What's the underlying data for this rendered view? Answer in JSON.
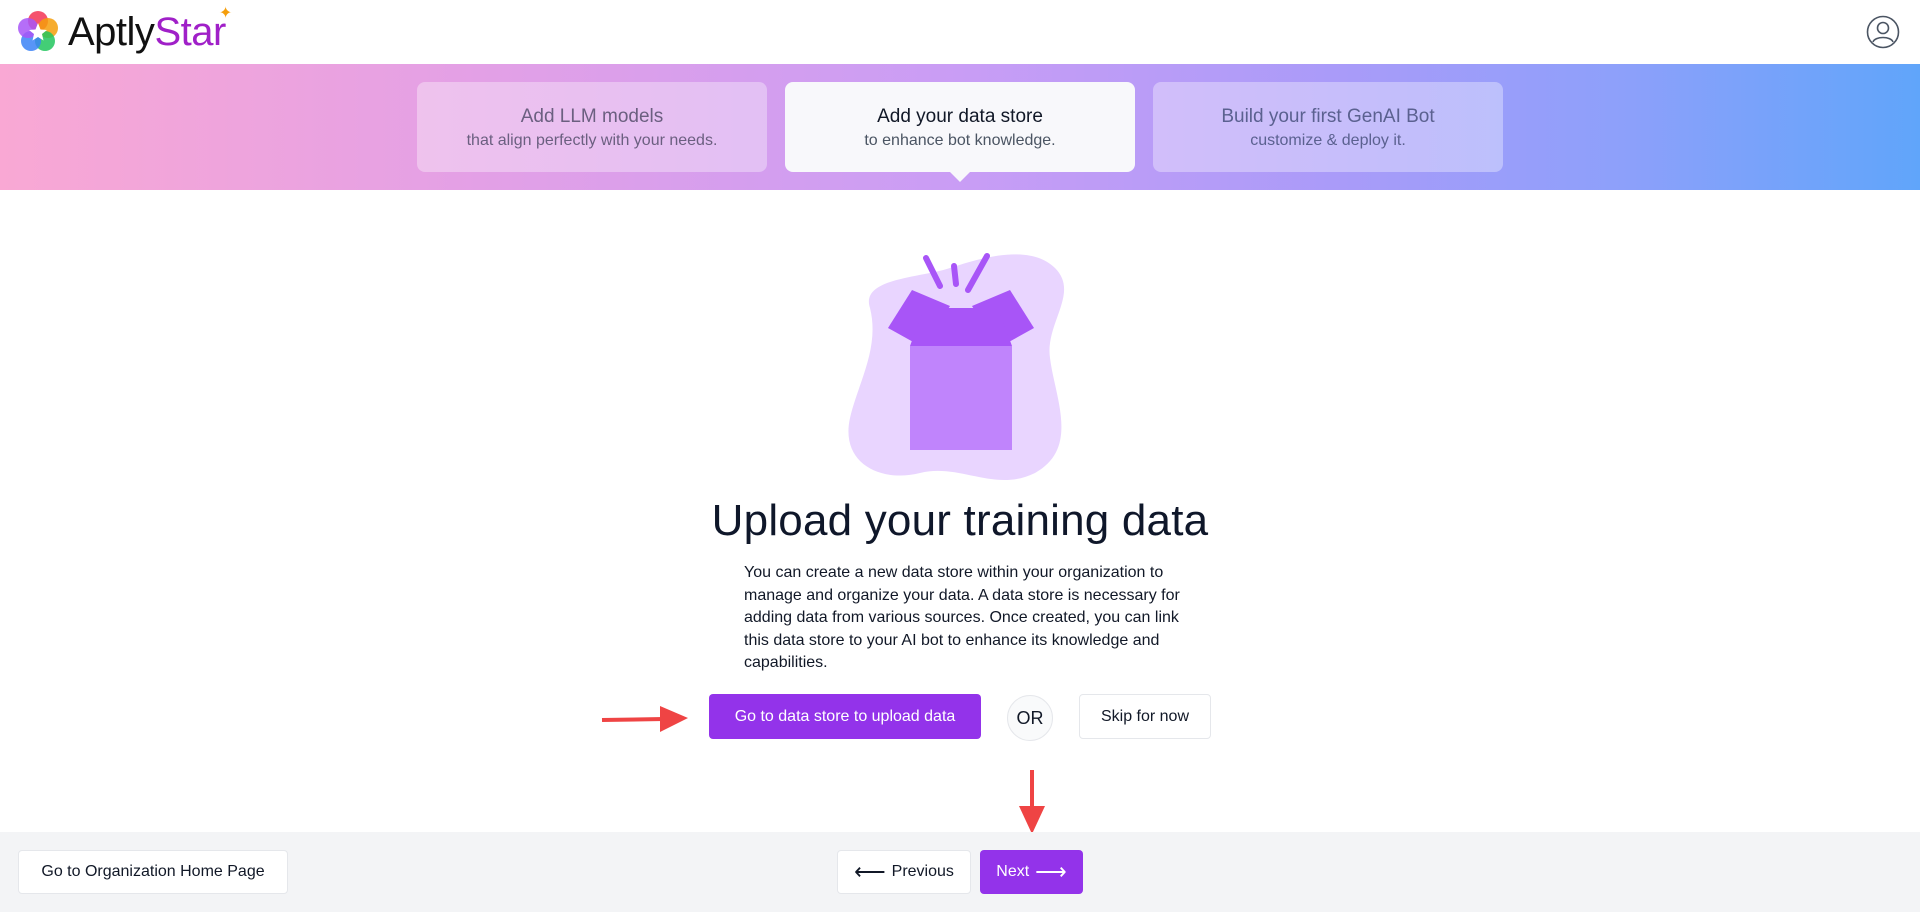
{
  "header": {
    "brand_part1": "Aptly",
    "brand_part2": "Star",
    "profile_icon": "user-circle-icon"
  },
  "stepper": {
    "steps": [
      {
        "title": "Add LLM models",
        "subtitle": "that align perfectly with your needs.",
        "state": "inactive"
      },
      {
        "title": "Add your data store",
        "subtitle": "to enhance bot knowledge.",
        "state": "active"
      },
      {
        "title": "Build your first GenAI Bot",
        "subtitle": "customize & deploy it.",
        "state": "inactive"
      }
    ]
  },
  "main": {
    "illustration": "open-box-icon",
    "title": "Upload your training data",
    "description": "You can create a new data store within your organization to manage and organize your data. A data store is necessary for adding data from various sources. Once created, you can link this data store to your AI bot to enhance its knowledge and capabilities.",
    "primary_button": "Go to data store to upload data",
    "or_label": "OR",
    "skip_button": "Skip for now"
  },
  "footer": {
    "home_button": "Go to Organization Home Page",
    "prev_button": "Previous",
    "next_button": "Next"
  },
  "colors": {
    "accent": "#9333ea",
    "annotation_arrow": "#ef4444"
  }
}
